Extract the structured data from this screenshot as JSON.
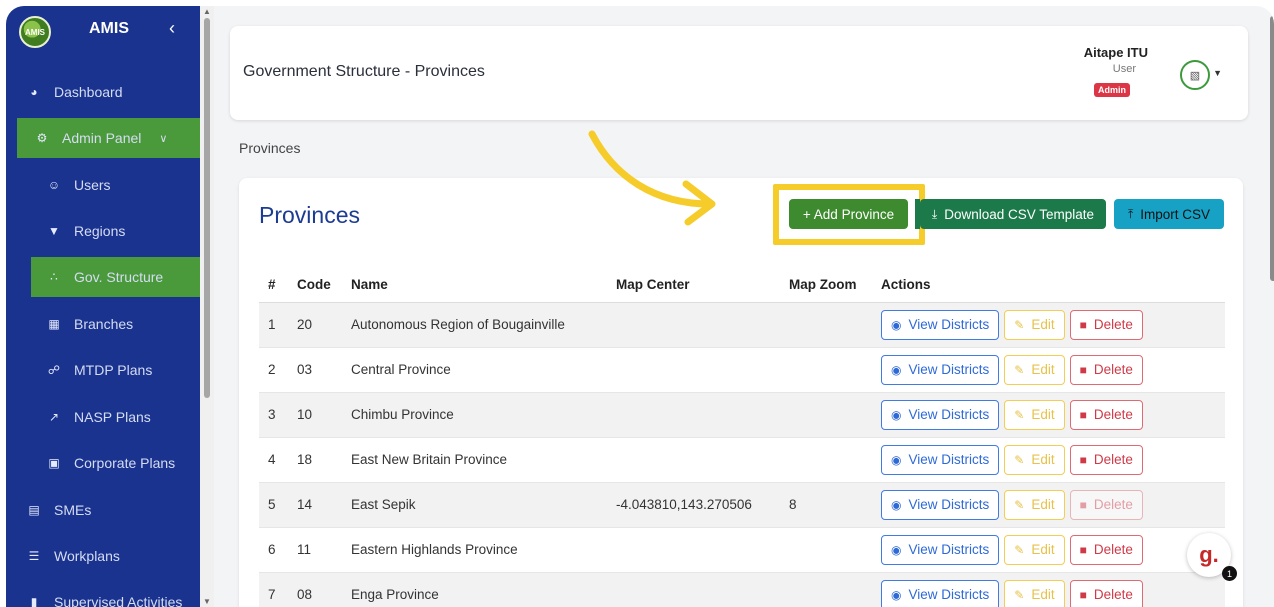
{
  "sidebar": {
    "logo_text": "AMIS",
    "brand": "AMIS",
    "collapse_icon": "chevron-left-icon",
    "items": [
      {
        "label": "Dashboard",
        "icon": "dashboard-icon"
      },
      {
        "label": "Admin Panel",
        "icon": "gear-icon"
      },
      {
        "label": "Users",
        "icon": "users-icon"
      },
      {
        "label": "Regions",
        "icon": "map-pin-icon"
      },
      {
        "label": "Gov. Structure",
        "icon": "org-chart-icon"
      },
      {
        "label": "Branches",
        "icon": "building-icon"
      },
      {
        "label": "MTDP Plans",
        "icon": "network-icon"
      },
      {
        "label": "NASP Plans",
        "icon": "chart-line-icon"
      },
      {
        "label": "Corporate Plans",
        "icon": "briefcase-icon"
      },
      {
        "label": "SMEs",
        "icon": "store-icon"
      },
      {
        "label": "Workplans",
        "icon": "list-icon"
      },
      {
        "label": "Supervised Activities",
        "icon": "clipboard-icon"
      }
    ]
  },
  "header": {
    "title": "Government Structure - Provinces",
    "user_name": "Aitape ITU",
    "user_role": "User",
    "badge": "Admin"
  },
  "breadcrumb": "Provinces",
  "card": {
    "title": "Provinces",
    "add_label": "+ Add Province",
    "csv_label": "Download CSV Template",
    "import_label": "Import CSV"
  },
  "table": {
    "headers": [
      "#",
      "Code",
      "Name",
      "Map Center",
      "Map Zoom",
      "Actions"
    ],
    "view_label": "View Districts",
    "edit_label": "Edit",
    "delete_label": "Delete",
    "rows": [
      {
        "num": "1",
        "code": "20",
        "name": "Autonomous Region of Bougainville",
        "center": "",
        "zoom": ""
      },
      {
        "num": "2",
        "code": "03",
        "name": "Central Province",
        "center": "",
        "zoom": ""
      },
      {
        "num": "3",
        "code": "10",
        "name": "Chimbu Province",
        "center": "",
        "zoom": ""
      },
      {
        "num": "4",
        "code": "18",
        "name": "East New Britain Province",
        "center": "",
        "zoom": ""
      },
      {
        "num": "5",
        "code": "14",
        "name": "East Sepik",
        "center": "-4.043810,143.270506",
        "zoom": "8"
      },
      {
        "num": "6",
        "code": "11",
        "name": "Eastern Highlands Province",
        "center": "",
        "zoom": ""
      },
      {
        "num": "7",
        "code": "08",
        "name": "Enga Province",
        "center": "",
        "zoom": ""
      }
    ]
  },
  "helper": {
    "logo": "g.",
    "count": "1"
  },
  "colors": {
    "sidebar": "#19338f",
    "active": "#4a9a3c",
    "highlight": "#f6cc2b",
    "title": "#1c3b93"
  }
}
